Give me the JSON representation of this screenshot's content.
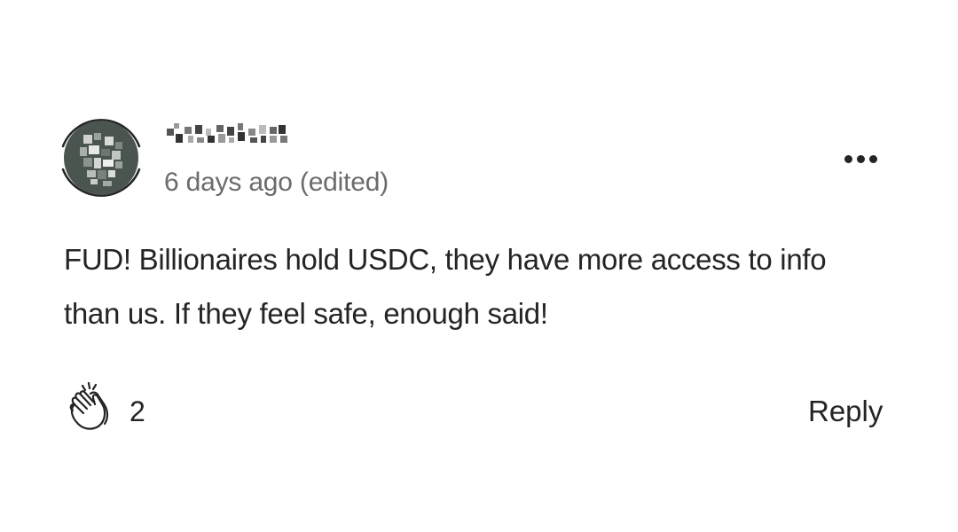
{
  "comment": {
    "author": {
      "name_obscured": true
    },
    "timestamp": "6 days ago (edited)",
    "body_lines": [
      "FUD! Billionaires hold USDC, they have more access to info",
      "than us. If they feel safe, enough said!"
    ],
    "more_icon": "more-horizontal-icon",
    "clap_icon": "clap-icon",
    "clap_count": "2",
    "reply_label": "Reply"
  },
  "colors": {
    "text_primary": "#242424",
    "text_secondary": "#6b6b6b",
    "avatar_bg": "#4a5550",
    "background": "#ffffff"
  }
}
